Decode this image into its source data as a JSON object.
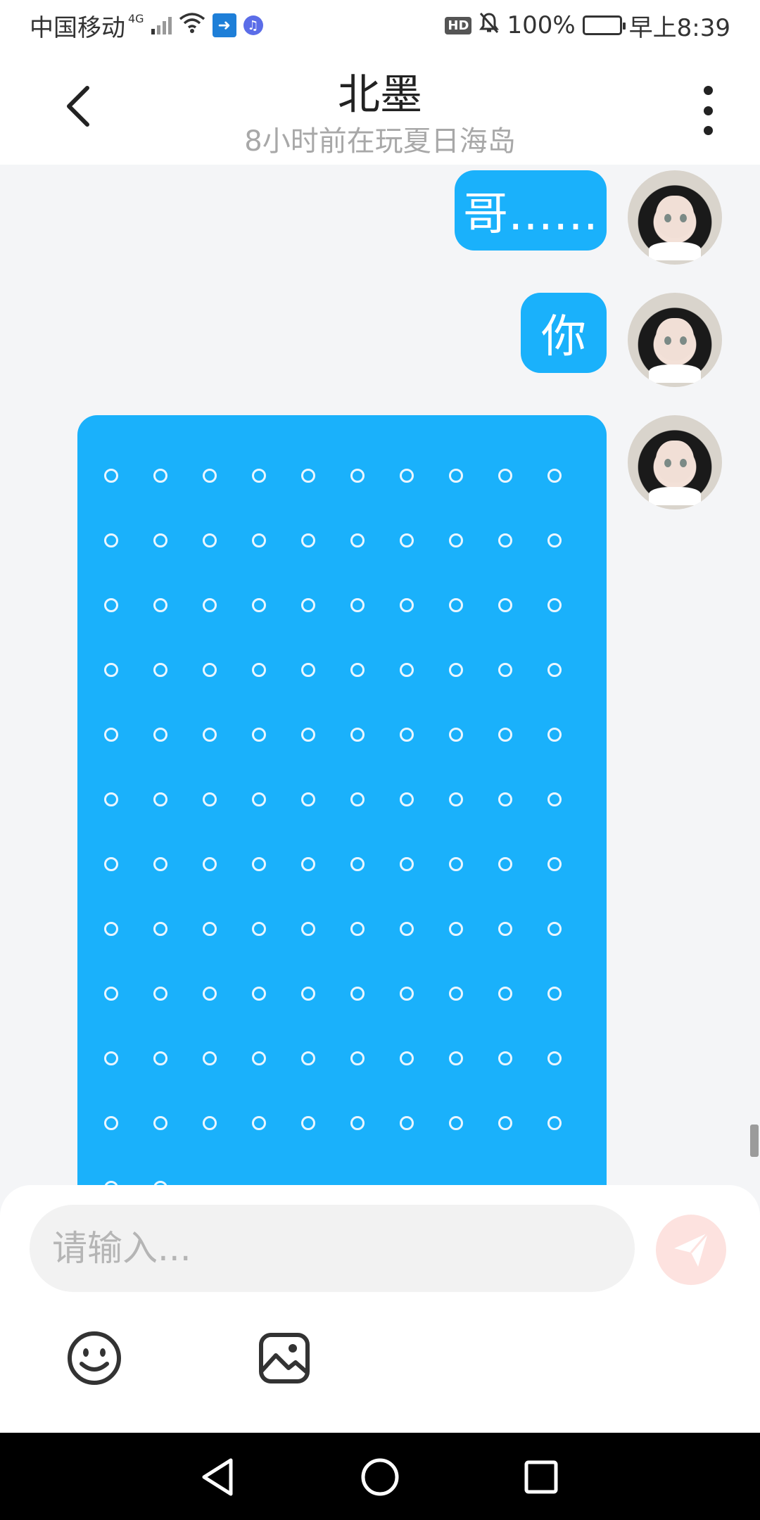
{
  "status_bar": {
    "carrier": "中国移动",
    "network": "4G",
    "battery": "100%",
    "time": "早上8:39",
    "hd": "HD"
  },
  "header": {
    "title": "北墨",
    "subtitle": "8小时前在玩夏日海岛"
  },
  "messages": [
    {
      "text": "哥……"
    },
    {
      "text": "你"
    },
    {
      "text": "",
      "dots_rows": 11,
      "dots_cols": 10,
      "partial_row_dots": 2
    }
  ],
  "input": {
    "placeholder": "请输入..."
  },
  "colors": {
    "bubble": "#1ab1fb",
    "send_button": "#fde2df",
    "background": "#f4f5f7"
  }
}
